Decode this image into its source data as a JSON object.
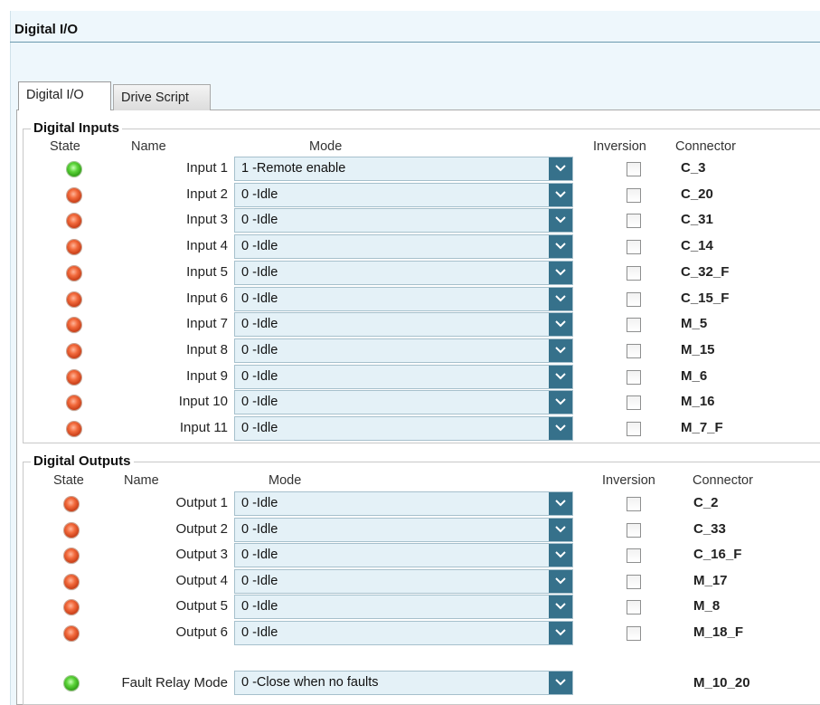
{
  "header": {
    "title": "Digital I/O"
  },
  "tabs": [
    {
      "label": "Digital I/O",
      "active": true
    },
    {
      "label": "Drive Script",
      "active": false
    }
  ],
  "inputs": {
    "title": "Digital Inputs",
    "headers": {
      "state": "State",
      "name": "Name",
      "mode": "Mode",
      "inversion": "Inversion",
      "connector": "Connector"
    },
    "rows": [
      {
        "state": "on",
        "name": "Input 1",
        "mode": "1  -Remote enable",
        "inverted": false,
        "connector": "C_3"
      },
      {
        "state": "off",
        "name": "Input 2",
        "mode": "0  -Idle",
        "inverted": false,
        "connector": "C_20"
      },
      {
        "state": "off",
        "name": "Input 3",
        "mode": "0  -Idle",
        "inverted": false,
        "connector": "C_31"
      },
      {
        "state": "off",
        "name": "Input 4",
        "mode": "0  -Idle",
        "inverted": false,
        "connector": "C_14"
      },
      {
        "state": "off",
        "name": "Input 5",
        "mode": "0  -Idle",
        "inverted": false,
        "connector": "C_32_F"
      },
      {
        "state": "off",
        "name": "Input 6",
        "mode": "0  -Idle",
        "inverted": false,
        "connector": "C_15_F"
      },
      {
        "state": "off",
        "name": "Input 7",
        "mode": "0  -Idle",
        "inverted": false,
        "connector": "M_5"
      },
      {
        "state": "off",
        "name": "Input 8",
        "mode": "0  -Idle",
        "inverted": false,
        "connector": "M_15"
      },
      {
        "state": "off",
        "name": "Input 9",
        "mode": "0  -Idle",
        "inverted": false,
        "connector": "M_6"
      },
      {
        "state": "off",
        "name": "Input 10",
        "mode": "0  -Idle",
        "inverted": false,
        "connector": "M_16"
      },
      {
        "state": "off",
        "name": "Input 11",
        "mode": "0  -Idle",
        "inverted": false,
        "connector": "M_7_F"
      }
    ]
  },
  "outputs": {
    "title": "Digital Outputs",
    "headers": {
      "state": "State",
      "name": "Name",
      "mode": "Mode",
      "inversion": "Inversion",
      "connector": "Connector"
    },
    "rows": [
      {
        "state": "off",
        "name": "Output 1",
        "mode": "0  -Idle",
        "inverted": false,
        "connector": "C_2"
      },
      {
        "state": "off",
        "name": "Output 2",
        "mode": "0  -Idle",
        "inverted": false,
        "connector": "C_33"
      },
      {
        "state": "off",
        "name": "Output 3",
        "mode": "0  -Idle",
        "inverted": false,
        "connector": "C_16_F"
      },
      {
        "state": "off",
        "name": "Output 4",
        "mode": "0  -Idle",
        "inverted": false,
        "connector": "M_17"
      },
      {
        "state": "off",
        "name": "Output 5",
        "mode": "0  -Idle",
        "inverted": false,
        "connector": "M_8"
      },
      {
        "state": "off",
        "name": "Output 6",
        "mode": "0  -Idle",
        "inverted": false,
        "connector": "M_18_F"
      }
    ],
    "fault_relay": {
      "state": "on",
      "label": "Fault Relay Mode",
      "mode": "0  -Close when no faults",
      "connector": "M_10_20"
    }
  },
  "colors": {
    "led_on": "#3cb521",
    "led_off": "#e0532a",
    "dropdown_button": "#36718b",
    "combo_background": "#e4f1f7"
  },
  "icons": {
    "led": "status-led-icon",
    "dropdown": "chevron-down-icon"
  }
}
